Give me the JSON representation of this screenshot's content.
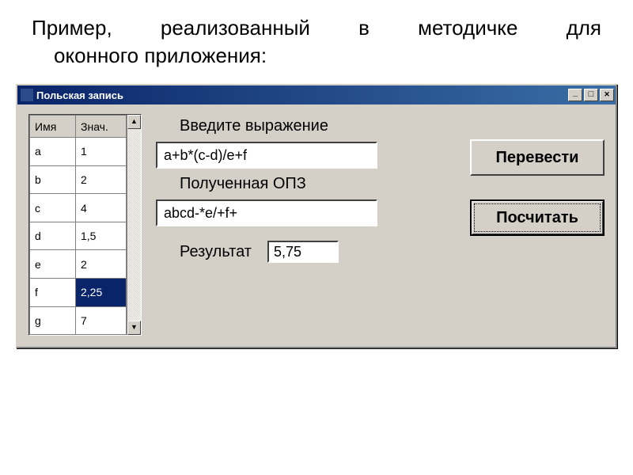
{
  "slide": {
    "line1": "Пример, реализованный в методичке для",
    "line2": "оконного приложения:"
  },
  "window": {
    "title": "Польская запись"
  },
  "grid": {
    "headers": {
      "name": "Имя",
      "value": "Знач."
    },
    "rows": [
      {
        "name": "a",
        "value": "1",
        "selected": false
      },
      {
        "name": "b",
        "value": "2",
        "selected": false
      },
      {
        "name": "c",
        "value": "4",
        "selected": false
      },
      {
        "name": "d",
        "value": "1,5",
        "selected": false
      },
      {
        "name": "e",
        "value": "2",
        "selected": false
      },
      {
        "name": "f",
        "value": "2,25",
        "selected": true
      },
      {
        "name": "g",
        "value": "7",
        "selected": false
      }
    ]
  },
  "labels": {
    "enter_expression": "Введите выражение",
    "rpn_result": "Полученная ОПЗ",
    "result": "Результат"
  },
  "fields": {
    "expression": "a+b*(c-d)/e+f",
    "rpn": "abcd-*e/+f+",
    "result": "5,75"
  },
  "buttons": {
    "translate": "Перевести",
    "calculate": "Посчитать"
  }
}
